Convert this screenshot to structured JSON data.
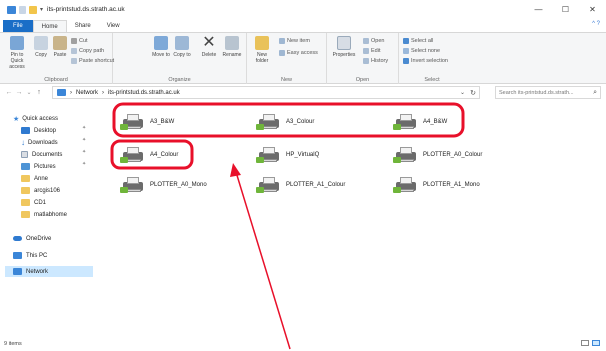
{
  "window": {
    "title": "its-printstud.ds.strath.ac.uk",
    "controls": {
      "minimize": "—",
      "maximize": "☐",
      "close": "✕"
    }
  },
  "ribbon_tabs": [
    "File",
    "Home",
    "Share",
    "View"
  ],
  "ribbon_help": "^ ?",
  "ribbon": {
    "clipboard": {
      "label": "Clipboard",
      "pin": "Pin to Quick access",
      "copy": "Copy",
      "paste": "Paste",
      "cut": "Cut",
      "copy_path": "Copy path",
      "paste_shortcut": "Paste shortcut"
    },
    "organize": {
      "label": "Organize",
      "move_to": "Move to",
      "copy_to": "Copy to",
      "delete": "Delete",
      "rename": "Rename"
    },
    "new": {
      "label": "New",
      "new_folder": "New folder",
      "new_item": "New item",
      "easy_access": "Easy access"
    },
    "open": {
      "label": "Open",
      "properties": "Properties",
      "open": "Open",
      "edit": "Edit",
      "history": "History"
    },
    "select": {
      "label": "Select",
      "select_all": "Select all",
      "select_none": "Select none",
      "invert": "Invert selection"
    }
  },
  "address": {
    "back": "←",
    "forward": "→",
    "recent": "⌄",
    "up": "↑",
    "crumbs": [
      "Network",
      "its-printstud.ds.strath.ac.uk"
    ],
    "separator": "›",
    "search_placeholder": "Search its-printstud.ds.strath...",
    "dropdown": "⌄",
    "refresh": "↻",
    "search_icon": "⌕"
  },
  "nav": {
    "quick_access": "Quick access",
    "desktop": "Desktop",
    "downloads": "Downloads",
    "documents": "Documents",
    "pictures": "Pictures",
    "anne": "Anne",
    "arcgis": "arcgis106",
    "cd1": "CD1",
    "matlab": "matlabhome",
    "onedrive": "OneDrive",
    "thispc": "This PC",
    "network": "Network",
    "pin_glyph": "📌"
  },
  "printers": [
    "A3_B&W",
    "A3_Colour",
    "A4_B&W",
    "A4_Colour",
    "HP_VirtualQ",
    "PLOTTER_A0_Colour",
    "PLOTTER_A0_Mono",
    "PLOTTER_A1_Colour",
    "PLOTTER_A1_Mono"
  ],
  "status": {
    "items": "9 items"
  },
  "colors": {
    "file_tab": "#1a6ec7",
    "annotation": "#e8102a",
    "selected_nav": "#cce8ff"
  }
}
